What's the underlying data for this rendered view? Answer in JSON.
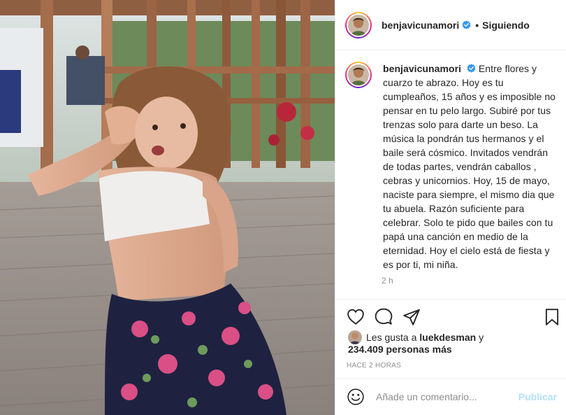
{
  "post": {
    "author": {
      "username": "benjavicunamori",
      "verified": true,
      "follow_status": "Siguiendo",
      "separator": "•"
    },
    "caption": {
      "username": "benjavicunamori",
      "text": "Entre flores y cuarzo te abrazo. Hoy es tu cumpleaños, 15 años y es imposible no pensar en tu pelo largo. Subiré por tus trenzas solo para darte un beso. La música la pondrán tus hermanos y el baile será cósmico. Invitados vendrán de todas partes, vendrán caballos , cebras y unicornios. Hoy, 15 de mayo, naciste para siempre, el mismo dia que tu abuela. Razón suficiente para celebrar. Solo te pido que bailes con tu papá una canción en medio de la eternidad. Hoy el cielo está de fiesta y es por ti, mi niña.",
      "time_ago": "2 h"
    },
    "actions": {
      "icons": [
        "heart-icon",
        "comment-icon",
        "share-icon",
        "bookmark-icon"
      ]
    },
    "likes": {
      "prefix": "Les gusta a",
      "user": "luekdesman",
      "conjunction": "y",
      "others": "234.409 personas más"
    },
    "posted": "HACE 2 HORAS",
    "comment": {
      "placeholder": "Añade un comentario...",
      "publish_label": "Publicar"
    }
  },
  "colors": {
    "text": "#262626",
    "secondary": "#8e8e8e",
    "verified": "#3897f0",
    "publish_disabled": "#b2dffc",
    "border": "#efefef"
  }
}
